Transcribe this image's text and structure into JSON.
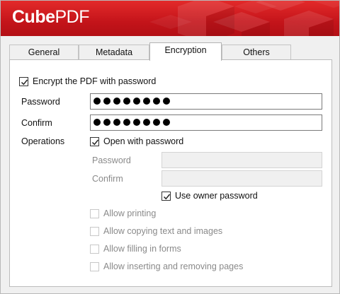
{
  "app": {
    "logo_bold": "Cube",
    "logo_light": "PDF"
  },
  "tabs": [
    {
      "label": "General",
      "active": false
    },
    {
      "label": "Metadata",
      "active": false
    },
    {
      "label": "Encryption",
      "active": true
    },
    {
      "label": "Others",
      "active": false
    }
  ],
  "encryption": {
    "enable_label": "Encrypt the PDF with password",
    "enable_checked": true,
    "password_label": "Password",
    "password_masked_length": 8,
    "confirm_label": "Confirm",
    "confirm_masked_length": 8,
    "operations_label": "Operations",
    "open_with_password_label": "Open with password",
    "open_with_password_checked": true,
    "user_password_label": "Password",
    "user_confirm_label": "Confirm",
    "use_owner_password_label": "Use owner password",
    "use_owner_password_checked": true,
    "permissions": [
      {
        "label": "Allow printing",
        "checked": false,
        "enabled": false
      },
      {
        "label": "Allow copying text and images",
        "checked": false,
        "enabled": false
      },
      {
        "label": "Allow filling in forms",
        "checked": false,
        "enabled": false
      },
      {
        "label": "Allow inserting and removing pages",
        "checked": false,
        "enabled": false
      }
    ]
  },
  "colors": {
    "brand_red": "#d01c22",
    "panel_bg": "#ffffff",
    "window_bg": "#f0f0f0",
    "disabled_text": "#8a8a8a"
  }
}
